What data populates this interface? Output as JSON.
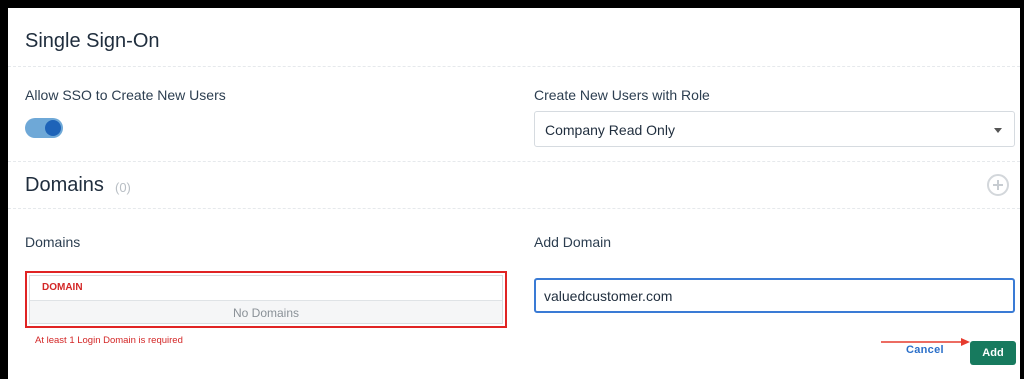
{
  "sso": {
    "title": "Single Sign-On",
    "allow_label": "Allow SSO to Create New Users",
    "allow_toggle_on": true,
    "role_label": "Create New Users with Role",
    "role_value": "Company Read Only"
  },
  "domains": {
    "heading": "Domains",
    "count": "(0)",
    "list_label": "Domains",
    "table_header": "DOMAIN",
    "empty_text": "No Domains",
    "error": "At least 1 Login Domain is required",
    "add_label": "Add Domain",
    "input_value": "valuedcustomer.com",
    "cancel_label": "Cancel",
    "add_button": "Add"
  },
  "colors": {
    "accent_blue": "#3a7bd5",
    "toggle_track": "#6ea8d7",
    "toggle_knob": "#1e63b8",
    "error_red": "#e02424",
    "add_button_green": "#177a5e",
    "annotation_arrow": "#e63b2e"
  },
  "icons": {
    "add_domain_icon": "circle-plus-icon",
    "select_caret": "chevron-down-icon",
    "annotation": "arrow-right-icon"
  }
}
